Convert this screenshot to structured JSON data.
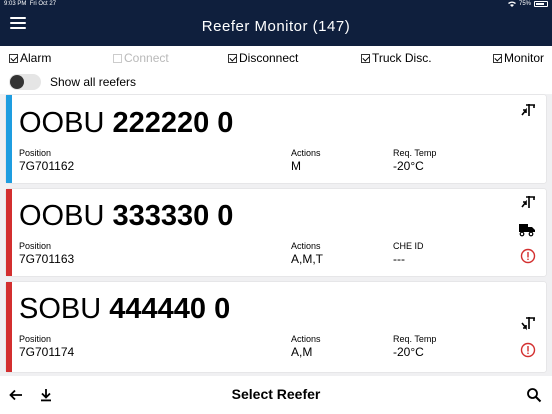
{
  "status": {
    "time": "9:03 PM",
    "date": "Fri Oct 27",
    "battery": "75%",
    "battery_level": 0.75
  },
  "header": {
    "title": "Reefer Monitor (147)",
    "menu_icon": "hamburger-menu-icon"
  },
  "filters": [
    {
      "label": "Alarm",
      "checked": true,
      "enabled": true
    },
    {
      "label": "Connect",
      "checked": false,
      "enabled": false
    },
    {
      "label": "Disconnect",
      "checked": true,
      "enabled": true
    },
    {
      "label": "Truck Disc.",
      "checked": true,
      "enabled": true
    },
    {
      "label": "Monitor",
      "checked": true,
      "enabled": true
    }
  ],
  "show_all": {
    "label": "Show all reefers",
    "on": false
  },
  "cards": [
    {
      "prefix": "OOBU",
      "number": "222220 0",
      "bar_color": "#1e9de0",
      "fields": [
        {
          "label": "Position",
          "value": "7G701162"
        },
        {
          "label": "Actions",
          "value": "M"
        },
        {
          "label": "Req. Temp",
          "value": "-20°C"
        }
      ],
      "icons": [
        "crane-connect-icon"
      ]
    },
    {
      "prefix": "OOBU",
      "number": "333330 0",
      "bar_color": "#d32f2f",
      "fields": [
        {
          "label": "Position",
          "value": "7G701163"
        },
        {
          "label": "Actions",
          "value": "A,M,T"
        },
        {
          "label": "CHE ID",
          "value": "---"
        }
      ],
      "icons": [
        "crane-connect-icon",
        "truck-icon",
        "alert-circle-icon"
      ]
    },
    {
      "prefix": "SOBU",
      "number": "444440 0",
      "bar_color": "#d32f2f",
      "fields": [
        {
          "label": "Position",
          "value": "7G701174"
        },
        {
          "label": "Actions",
          "value": "A,M"
        },
        {
          "label": "Req. Temp",
          "value": "-20°C"
        }
      ],
      "icons": [
        "crane-disconnect-icon",
        "alert-circle-icon"
      ]
    }
  ],
  "bottom": {
    "title": "Select Reefer",
    "back_icon": "back-arrow-icon",
    "download_icon": "download-icon",
    "search_icon": "search-icon"
  },
  "colors": {
    "header_bg": "#0f1f3d",
    "alert_red": "#d32f2f",
    "accent_blue": "#1e9de0"
  }
}
